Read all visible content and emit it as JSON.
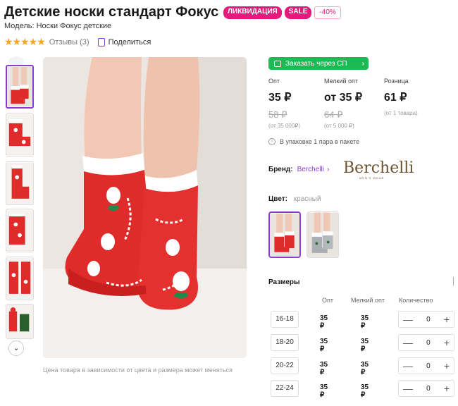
{
  "product": {
    "title": "Детские носки стандарт Фокус",
    "badges": {
      "liquidation": "ЛИКВИДАЦИЯ",
      "sale": "SALE",
      "discount": "-40%"
    },
    "model": "Модель: Носки Фокус детские",
    "stars": "★★★★★",
    "reviews": "Отзывы (3)",
    "share": "Поделиться"
  },
  "gallery": {
    "caption": "Цена товара в зависимости от цвета и размера может меняться",
    "down_arrow": "⌄"
  },
  "order_button": {
    "label": "Заказать через СП",
    "chevron": "›"
  },
  "prices": [
    {
      "label": "Опт",
      "value": "35 ₽",
      "old": "58 ₽",
      "note": "(от 35 000₽)"
    },
    {
      "label": "Мелкий опт",
      "value": "от 35 ₽",
      "old": "64 ₽",
      "note": "(от 5 000 ₽)"
    },
    {
      "label": "Розница",
      "value": "61 ₽",
      "old": "",
      "note": "(от 1 товара)"
    }
  ],
  "package_note": "В упаковке 1 пара в пакете",
  "info_icon": "i",
  "brand": {
    "key": "Бренд:",
    "value": "Berchelli",
    "chevron": "›",
    "logo": "Berchelli",
    "logo_sub": "MEN'S WEAR"
  },
  "color": {
    "key": "Цвет:",
    "value": "красный"
  },
  "sizes": {
    "title": "Размеры",
    "headers": {
      "opt": "Опт",
      "small_opt": "Мелкий опт",
      "qty": "Количество"
    },
    "rows": [
      {
        "size": "16-18",
        "opt": "35 ₽",
        "small": "35 ₽",
        "qty": "0"
      },
      {
        "size": "18-20",
        "opt": "35 ₽",
        "small": "35 ₽",
        "qty": "0"
      },
      {
        "size": "20-22",
        "opt": "35 ₽",
        "small": "35 ₽",
        "qty": "0"
      },
      {
        "size": "22-24",
        "opt": "35 ₽",
        "small": "35 ₽",
        "qty": "0"
      }
    ],
    "minus": "—",
    "plus": "+"
  },
  "colors": {
    "red": "#e02b2b",
    "sock_white": "#ffffff",
    "accent": "#8a3dd1",
    "green": "#1db954",
    "pink": "#e6197d"
  }
}
